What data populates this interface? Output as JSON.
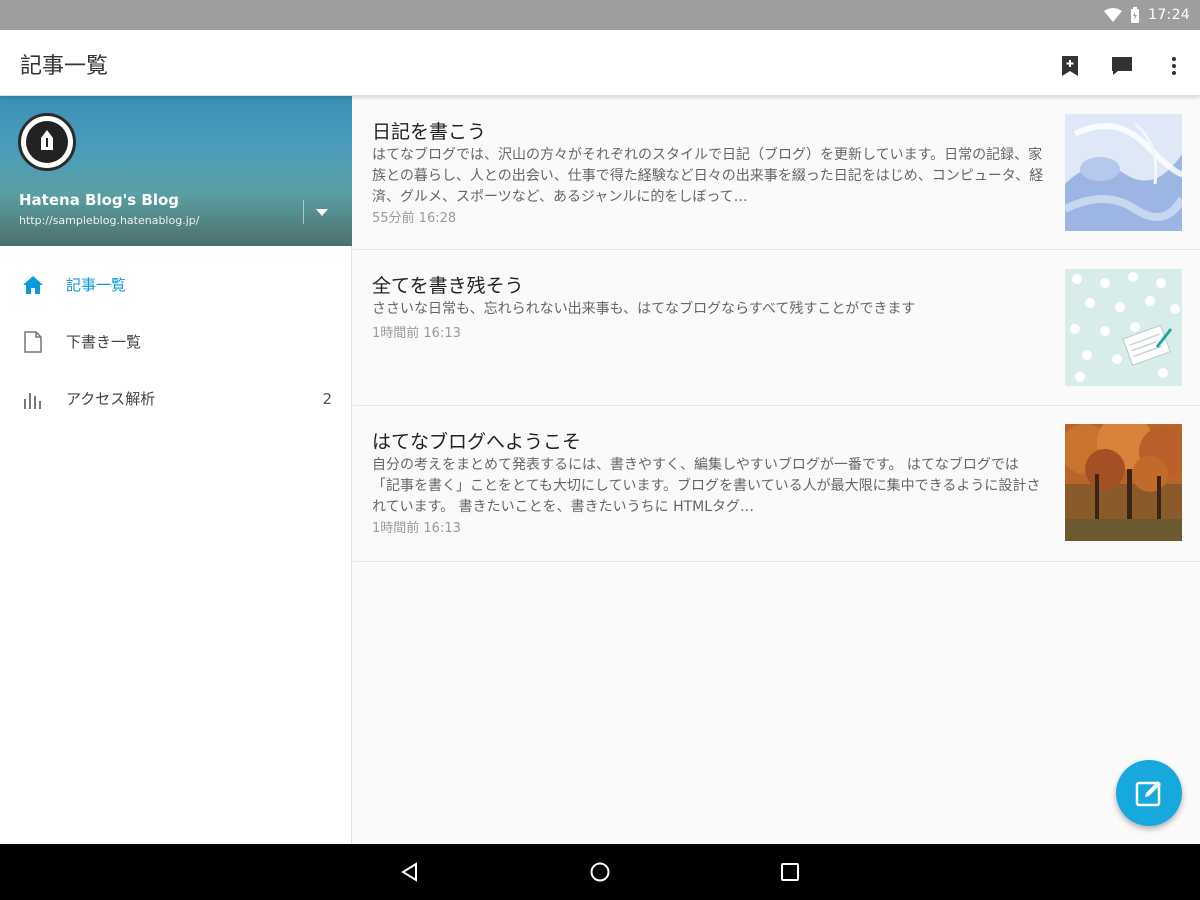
{
  "status": {
    "time": "17:24"
  },
  "appbar": {
    "title": "記事一覧",
    "icons": [
      "bookmark-add-icon",
      "comment-icon",
      "more-vert-icon"
    ]
  },
  "sidebar": {
    "blog_name": "Hatena Blog's Blog",
    "blog_url": "http://sampleblog.hatenablog.jp/",
    "items": [
      {
        "label": "記事一覧",
        "icon": "home-icon",
        "active": true
      },
      {
        "label": "下書き一覧",
        "icon": "draft-icon"
      },
      {
        "label": "アクセス解析",
        "icon": "bar-chart-icon",
        "count": "2"
      }
    ]
  },
  "entries": [
    {
      "title": "日記を書こう",
      "body": "はてなブログでは、沢山の方々がそれぞれのスタイルで日記（ブログ）を更新しています。日常の記録、家族との暮らし、人との出会い、仕事で得た経験など日々の出来事を綴った日記をはじめ、コンピュータ、経済、グルメ、スポーツなど、あるジャンルに的をしぼって…",
      "time": "55分前 16:28"
    },
    {
      "title": "全てを書き残そう",
      "body": "ささいな日常も、忘れられない出来事も、はてなブログならすべて残すことができます",
      "time": "1時間前 16:13"
    },
    {
      "title": "はてなブログへようこそ",
      "body": "自分の考えをまとめて発表するには、書きやすく、編集しやすいブログが一番です。 はてなブログでは「記事を書く」ことをとても大切にしています。ブログを書いている人が最大限に集中できるように設計されています。 書きたいことを、書きたいうちに HTMLタグ…",
      "time": "1時間前 16:13"
    }
  ],
  "colors": {
    "accent": "#17a9dd",
    "active_nav": "#0a9bd6",
    "statusbar": "#9e9e9e"
  }
}
